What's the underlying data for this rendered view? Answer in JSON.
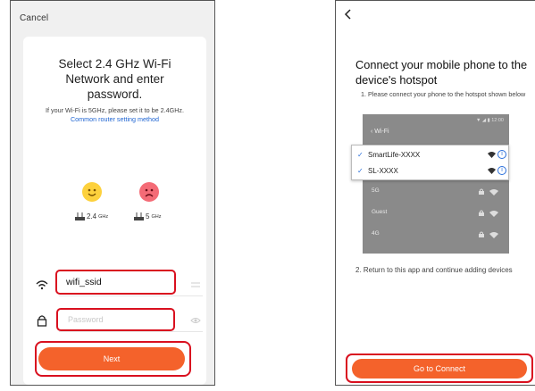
{
  "left": {
    "cancel": "Cancel",
    "title": "Select 2.4 GHz Wi-Fi Network and enter password.",
    "note_text": "If your Wi-Fi is 5GHz, please set it to be 2.4GHz.",
    "note_link": "Common router setting method",
    "band_24": "2.4",
    "band_24_unit": "GHz",
    "band_5": "5",
    "band_5_unit": "GHz",
    "ssid_value": "wifi_ssid",
    "password_placeholder": "Password",
    "next_label": "Next"
  },
  "right": {
    "title": "Connect your mobile phone to the device's hotspot",
    "step1": "1. Please connect your phone to the hotspot shown below",
    "mock_status": "▼ ◢ ▮ 12:00",
    "mock_header": "‹  Wi-Fi",
    "popup_networks": [
      "SmartLife-XXXX",
      "SL-XXXX"
    ],
    "mock_networks": [
      "5G",
      "Guest",
      "4G"
    ],
    "step2": "2. Return to this app and continue adding devices",
    "connect_label": "Go to Connect"
  },
  "colors": {
    "accent": "#f4622b",
    "highlight": "#d9101f",
    "link": "#1e64d2"
  }
}
